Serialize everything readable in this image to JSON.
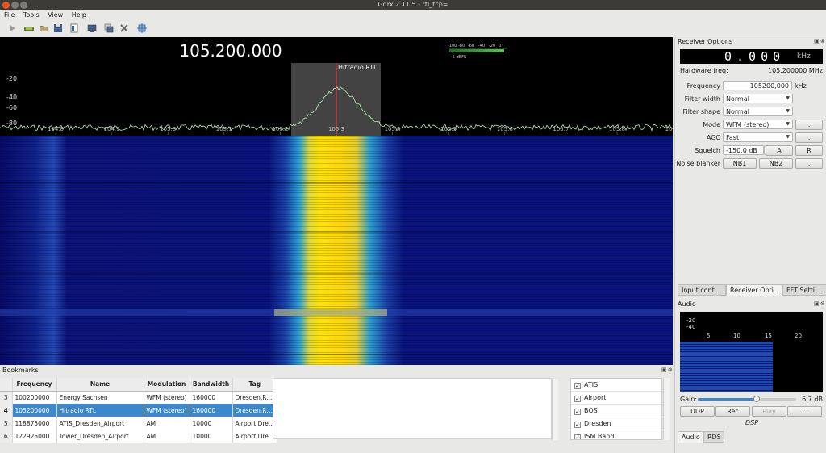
{
  "window": {
    "title": "Gqrx 2.11.5 - rtl_tcp="
  },
  "menu": [
    "File",
    "Tools",
    "View",
    "Help"
  ],
  "toolbar_icons": [
    "play-icon",
    "hardware-icon",
    "open-icon",
    "save-icon",
    "document-icon",
    "screen-icon",
    "copy-icon",
    "tools-icon",
    "network-icon"
  ],
  "spectrum": {
    "frequency_display": "105.200.000",
    "db_ticks": [
      "-20",
      "-40",
      "-60",
      "-80"
    ],
    "freq_ticks": [
      "104.8",
      "104.9",
      "105.0",
      "105.1",
      "105.2",
      "105.3",
      "105.4",
      "105.5",
      "105.6",
      "105.7",
      "105.8",
      "105.9"
    ],
    "bookmark_label": "Hitradio RTL",
    "smeter_ticks": [
      "-100",
      "-80",
      "-60",
      "-40",
      "-20",
      "0"
    ],
    "smeter_value": "-5 dBFS"
  },
  "bookmarks": {
    "title": "Bookmarks",
    "columns": [
      "Frequency",
      "Name",
      "Modulation",
      "Bandwidth",
      "Tag"
    ],
    "rows": [
      {
        "num": "3",
        "freq": "100200000",
        "name": "Energy Sachsen",
        "mod": "WFM (stereo)",
        "bw": "160000",
        "tag": "Dresden,R..."
      },
      {
        "num": "4",
        "freq": "105200000",
        "name": "Hitradio RTL",
        "mod": "WFM (stereo)",
        "bw": "160000",
        "tag": "Dresden,R..."
      },
      {
        "num": "5",
        "freq": "118875000",
        "name": "ATIS_Dresden_Airport",
        "mod": "AM",
        "bw": "10000",
        "tag": "Airport,Dre..."
      },
      {
        "num": "6",
        "freq": "122925000",
        "name": "Tower_Dresden_Airport",
        "mod": "AM",
        "bw": "10000",
        "tag": "Airport,Dre..."
      }
    ],
    "selected_row": 1,
    "tags": [
      "ATIS",
      "Airport",
      "BOS",
      "Dresden",
      "ISM Band"
    ]
  },
  "receiver": {
    "title": "Receiver Options",
    "lcd_value": "0.000",
    "lcd_unit": "kHz",
    "hw_freq_label": "Hardware freq:",
    "hw_freq_value": "105.200000 MHz",
    "frequency_label": "Frequency",
    "frequency_value": "105200,000",
    "frequency_unit": "kHz",
    "filter_width_label": "Filter width",
    "filter_width_value": "Normal",
    "filter_shape_label": "Filter shape",
    "filter_shape_value": "Normal",
    "mode_label": "Mode",
    "mode_value": "WFM (stereo)",
    "agc_label": "AGC",
    "agc_value": "Fast",
    "squelch_label": "Squelch",
    "squelch_value": "-150,0 dB",
    "squelch_a": "A",
    "squelch_r": "R",
    "nb_label": "Noise blanker",
    "nb1": "NB1",
    "nb2": "NB2",
    "more": "..."
  },
  "tabs_top": [
    "Input cont...",
    "Receiver Opti...",
    "FFT Setti..."
  ],
  "audio": {
    "title": "Audio",
    "db_ticks": [
      "-20",
      "-40"
    ],
    "freq_ticks": [
      "5",
      "10",
      "15",
      "20"
    ],
    "gain_label": "Gain:",
    "gain_value": "6.7 dB",
    "gain_level": 0.6,
    "udp": "UDP",
    "rec": "Rec",
    "play": "Play",
    "more": "...",
    "dsp_label": "DSP"
  },
  "tabs_bottom": [
    "Audio",
    "RDS"
  ],
  "colors": {
    "spectrum_trace": "#b8f0b8",
    "selected_row": "#3d87cd",
    "marker": "#ff3030",
    "close_button": "#e9541d"
  }
}
